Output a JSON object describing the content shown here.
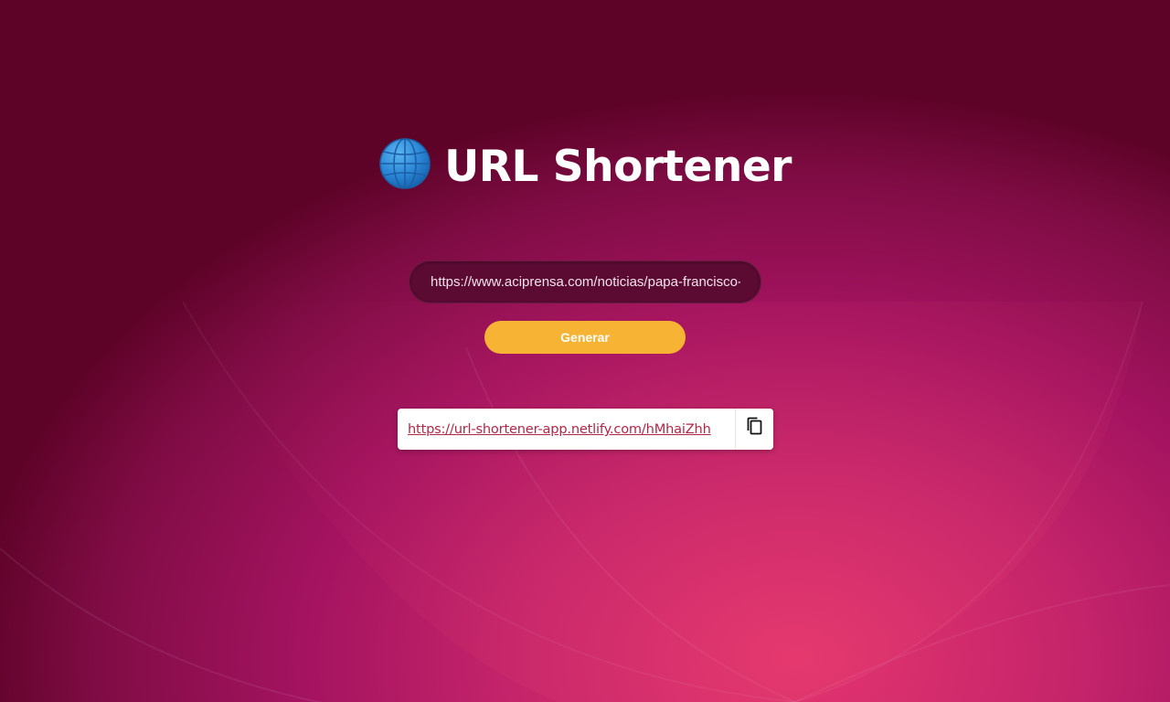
{
  "app": {
    "title": "URL Shortener",
    "title_icon": "globe-icon"
  },
  "form": {
    "url_value": "https://www.aciprensa.com/noticias/papa-francisco-",
    "generate_label": "Generar"
  },
  "result": {
    "short_url": "https://url-shortener-app.netlify.com/hMhaiZhh",
    "copy_icon": "copy-icon"
  },
  "colors": {
    "button_accent": "#f7b334",
    "link": "#b32746",
    "input_bg": "#5b0a32",
    "background_dark": "#5e0328",
    "background_light": "#e4356f"
  }
}
